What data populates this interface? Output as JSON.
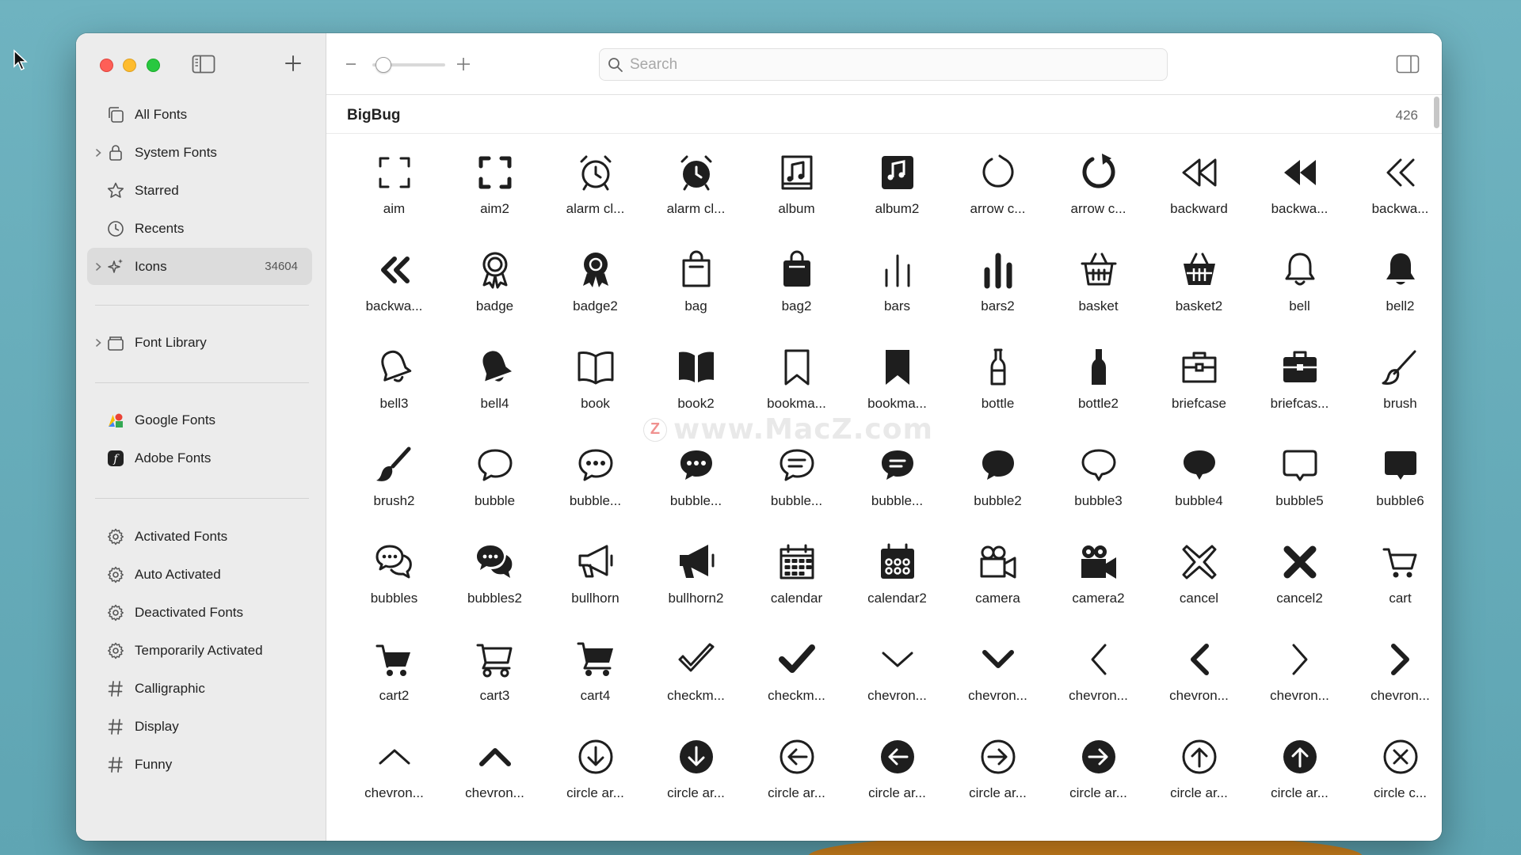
{
  "sidebar": {
    "library_items": [
      {
        "label": "All Fonts",
        "icon": "all-fonts-icon",
        "chevron": false
      },
      {
        "label": "System Fonts",
        "icon": "lock-icon",
        "chevron": true
      },
      {
        "label": "Starred",
        "icon": "star-icon",
        "chevron": false
      },
      {
        "label": "Recents",
        "icon": "clock-icon",
        "chevron": false
      },
      {
        "label": "Icons",
        "icon": "sparkles-icon",
        "chevron": true,
        "count": "34604",
        "selected": true
      }
    ],
    "font_library": {
      "label": "Font Library",
      "icon": "box-icon"
    },
    "services": [
      {
        "label": "Google Fonts",
        "icon": "google-fonts-icon"
      },
      {
        "label": "Adobe Fonts",
        "icon": "adobe-fonts-icon"
      }
    ],
    "smart_collections": [
      {
        "label": "Activated Fonts",
        "icon": "gear-icon"
      },
      {
        "label": "Auto Activated",
        "icon": "gear-icon"
      },
      {
        "label": "Deactivated Fonts",
        "icon": "gear-icon"
      },
      {
        "label": "Temporarily Activated",
        "icon": "gear-icon"
      },
      {
        "label": "Calligraphic",
        "icon": "hash-icon"
      },
      {
        "label": "Display",
        "icon": "hash-icon"
      },
      {
        "label": "Funny",
        "icon": "hash-icon"
      }
    ]
  },
  "toolbar": {
    "search_placeholder": "Search",
    "zoom_level": 0.05
  },
  "section": {
    "title": "BigBug",
    "count": "426"
  },
  "watermark": {
    "text": "www.MacZ.com",
    "logo": "Z"
  },
  "glyphs": [
    {
      "name": "aim",
      "icon": "aim"
    },
    {
      "name": "aim2",
      "icon": "aim2"
    },
    {
      "name": "alarm cl...",
      "icon": "alarm"
    },
    {
      "name": "alarm cl...",
      "icon": "alarm2"
    },
    {
      "name": "album",
      "icon": "album"
    },
    {
      "name": "album2",
      "icon": "album2"
    },
    {
      "name": "arrow c...",
      "icon": "arrowc"
    },
    {
      "name": "arrow c...",
      "icon": "arrowc2"
    },
    {
      "name": "backward",
      "icon": "backward"
    },
    {
      "name": "backwa...",
      "icon": "backward2"
    },
    {
      "name": "backwa...",
      "icon": "backward3"
    },
    {
      "name": "backwa...",
      "icon": "backward4"
    },
    {
      "name": "badge",
      "icon": "badge"
    },
    {
      "name": "badge2",
      "icon": "badge2"
    },
    {
      "name": "bag",
      "icon": "bag"
    },
    {
      "name": "bag2",
      "icon": "bag2"
    },
    {
      "name": "bars",
      "icon": "bars"
    },
    {
      "name": "bars2",
      "icon": "bars2"
    },
    {
      "name": "basket",
      "icon": "basket"
    },
    {
      "name": "basket2",
      "icon": "basket2"
    },
    {
      "name": "bell",
      "icon": "bell"
    },
    {
      "name": "bell2",
      "icon": "bell2"
    },
    {
      "name": "bell3",
      "icon": "bell3"
    },
    {
      "name": "bell4",
      "icon": "bell4"
    },
    {
      "name": "book",
      "icon": "book"
    },
    {
      "name": "book2",
      "icon": "book2"
    },
    {
      "name": "bookma...",
      "icon": "bookmark"
    },
    {
      "name": "bookma...",
      "icon": "bookmark2"
    },
    {
      "name": "bottle",
      "icon": "bottle"
    },
    {
      "name": "bottle2",
      "icon": "bottle2"
    },
    {
      "name": "briefcase",
      "icon": "briefcase"
    },
    {
      "name": "briefcas...",
      "icon": "briefcase2"
    },
    {
      "name": "brush",
      "icon": "brush"
    },
    {
      "name": "brush2",
      "icon": "brush2"
    },
    {
      "name": "bubble",
      "icon": "bubble"
    },
    {
      "name": "bubble...",
      "icon": "bubbledots"
    },
    {
      "name": "bubble...",
      "icon": "bubbledots2"
    },
    {
      "name": "bubble...",
      "icon": "bubblelines"
    },
    {
      "name": "bubble...",
      "icon": "bubblelines2"
    },
    {
      "name": "bubble2",
      "icon": "bubble2"
    },
    {
      "name": "bubble3",
      "icon": "bubble3"
    },
    {
      "name": "bubble4",
      "icon": "bubble4"
    },
    {
      "name": "bubble5",
      "icon": "bubble5"
    },
    {
      "name": "bubble6",
      "icon": "bubble6"
    },
    {
      "name": "bubbles",
      "icon": "bubbles"
    },
    {
      "name": "bubbles2",
      "icon": "bubbles2"
    },
    {
      "name": "bullhorn",
      "icon": "bullhorn"
    },
    {
      "name": "bullhorn2",
      "icon": "bullhorn2"
    },
    {
      "name": "calendar",
      "icon": "calendar"
    },
    {
      "name": "calendar2",
      "icon": "calendar2"
    },
    {
      "name": "camera",
      "icon": "camera"
    },
    {
      "name": "camera2",
      "icon": "camera2"
    },
    {
      "name": "cancel",
      "icon": "cancel"
    },
    {
      "name": "cancel2",
      "icon": "cancel2"
    },
    {
      "name": "cart",
      "icon": "cart"
    },
    {
      "name": "cart2",
      "icon": "cart2"
    },
    {
      "name": "cart3",
      "icon": "cart3"
    },
    {
      "name": "cart4",
      "icon": "cart4"
    },
    {
      "name": "checkm...",
      "icon": "check"
    },
    {
      "name": "checkm...",
      "icon": "check2"
    },
    {
      "name": "chevron...",
      "icon": "chevdown"
    },
    {
      "name": "chevron...",
      "icon": "chevdown2"
    },
    {
      "name": "chevron...",
      "icon": "chevleft"
    },
    {
      "name": "chevron...",
      "icon": "chevleft2"
    },
    {
      "name": "chevron...",
      "icon": "chevright"
    },
    {
      "name": "chevron...",
      "icon": "chevright2"
    },
    {
      "name": "chevron...",
      "icon": "chevup"
    },
    {
      "name": "chevron...",
      "icon": "chevup2"
    },
    {
      "name": "circle ar...",
      "icon": "cdown"
    },
    {
      "name": "circle ar...",
      "icon": "cdown2"
    },
    {
      "name": "circle ar...",
      "icon": "cleft"
    },
    {
      "name": "circle ar...",
      "icon": "cleft2"
    },
    {
      "name": "circle ar...",
      "icon": "cright"
    },
    {
      "name": "circle ar...",
      "icon": "cright2"
    },
    {
      "name": "circle ar...",
      "icon": "cup"
    },
    {
      "name": "circle ar...",
      "icon": "cup2"
    },
    {
      "name": "circle c...",
      "icon": "cclose"
    }
  ]
}
